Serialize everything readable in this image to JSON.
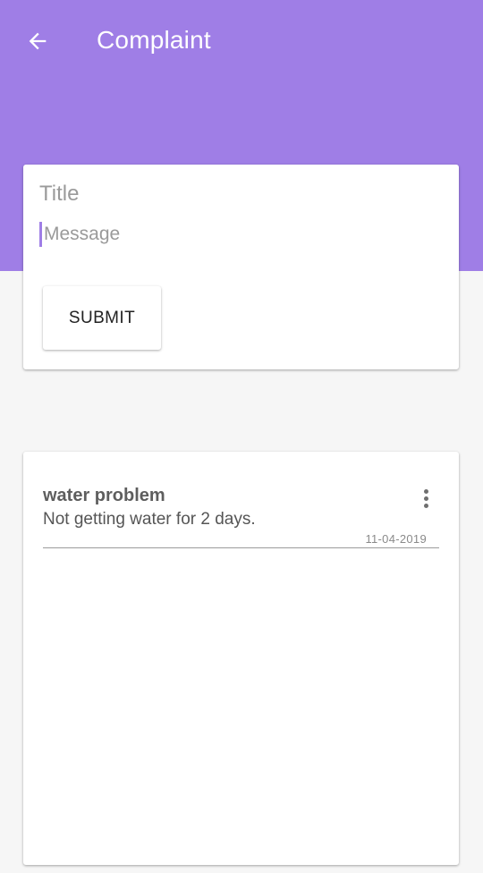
{
  "colors": {
    "primary": "#9f7ee6",
    "background": "#f6f6f6",
    "card": "#ffffff"
  },
  "appbar": {
    "back_icon": "arrow-left-icon",
    "title": "Complaint"
  },
  "form": {
    "title_placeholder": "Title",
    "title_value": "",
    "message_placeholder": "Message",
    "message_value": "",
    "submit_label": "SUBMIT"
  },
  "complaints": [
    {
      "title": "water problem",
      "message": "Not getting water for 2 days.",
      "date": "11-04-2019",
      "menu_icon": "more-vert-icon"
    }
  ]
}
